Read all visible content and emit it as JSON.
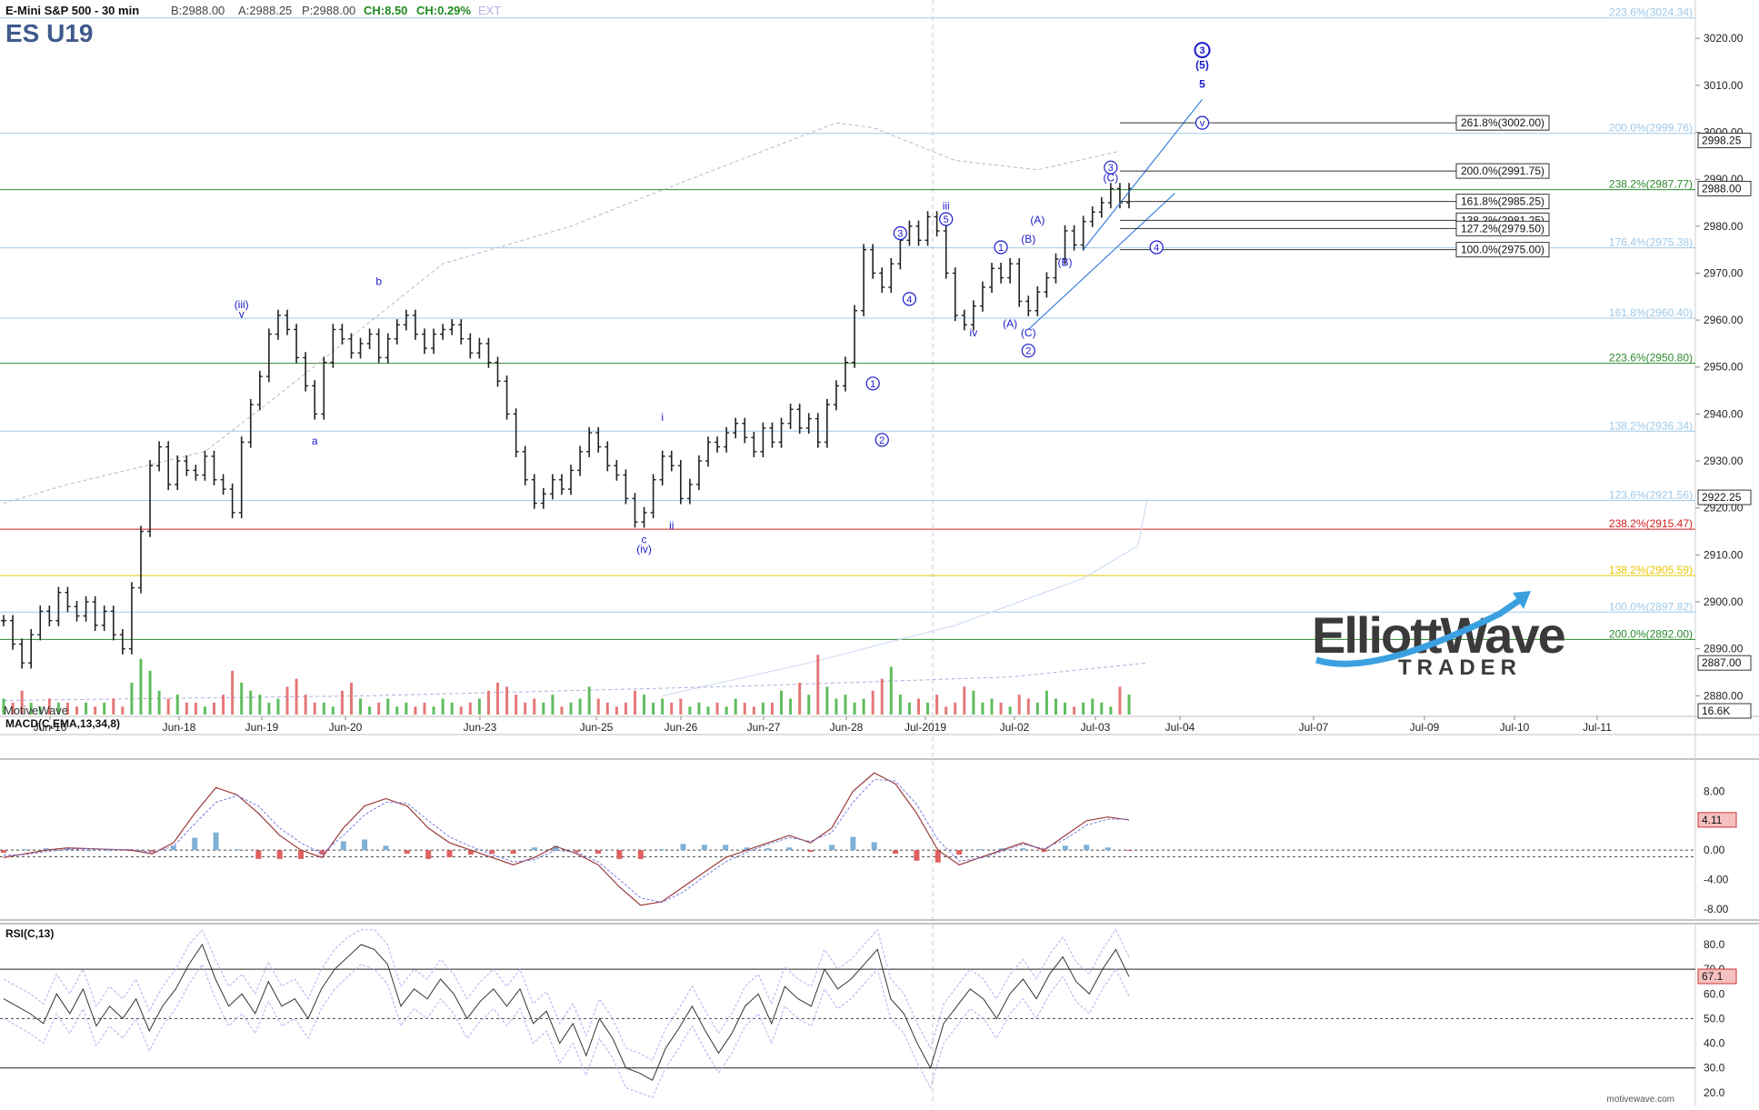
{
  "header": {
    "instrument": "E-Mini S&P 500 - 30 min",
    "quote_b": "B:2988.00",
    "quote_a": "A:2988.25",
    "quote_p": "P:2988.00",
    "quote_ch": "CH:8.50",
    "quote_chp": "CH:0.29%",
    "quote_ext": "EXT",
    "symbol": "ES U19"
  },
  "watermark": "MotiveWave",
  "footer_brand": "motivewave.com",
  "logo": {
    "line1": "ElliottWave",
    "line2": "TRADER"
  },
  "colors": {
    "bg": "#ffffff",
    "bar": "#222222",
    "fib_blue": "#9fc9e8",
    "fib_green": "#2f8a2f",
    "fib_red": "#d42020",
    "fib_yellow": "#e8c600",
    "wave": "#1a1acc",
    "channel": "#3a7fd9",
    "vol_up": "#43b243",
    "vol_down": "#e06060",
    "macd_line": "#9b3a3a",
    "macd_signal": "#7a7ae0",
    "hist_pos": "#7fb0d6",
    "hist_neg": "#e06060"
  },
  "chart_data": [
    {
      "type": "line",
      "title": "E-Mini S&P 500 - 30 min",
      "subtitle": "ES U19",
      "x_tick_labels": [
        "Jun-16",
        "Jun-18",
        "Jun-19",
        "Jun-20",
        "Jun-23",
        "Jun-25",
        "Jun-26",
        "Jun-27",
        "Jun-28",
        "Jul-2019",
        "Jul-02",
        "Jul-03",
        "Jul-04",
        "Jul-07",
        "Jul-09",
        "Jul-10",
        "Jul-11"
      ],
      "y_tick_labels": [
        "3020.00",
        "3010.00",
        "3000.00",
        "2990.00",
        "2980.00",
        "2970.00",
        "2960.00",
        "2950.00",
        "2940.00",
        "2930.00",
        "2920.00",
        "2910.00",
        "2900.00",
        "2890.00",
        "2880.00"
      ],
      "ylim": [
        2876,
        3027
      ],
      "last_price_label": "2988.00",
      "price_flags": [
        "2998.25",
        "2922.25",
        "2887.00",
        "16.6K"
      ],
      "series": [
        {
          "values": [
            2896,
            2891,
            2887,
            2893,
            2898,
            2896,
            2902,
            2899,
            2897,
            2900,
            2895,
            2898,
            2893,
            2890,
            2903,
            2915,
            2929,
            2933,
            2925,
            2930,
            2928,
            2927,
            2931,
            2926,
            2924,
            2919,
            2934,
            2942,
            2948,
            2957,
            2961,
            2958,
            2952,
            2946,
            2940,
            2951,
            2958,
            2956,
            2953,
            2955,
            2957,
            2952,
            2956,
            2959,
            2961,
            2957,
            2954,
            2957,
            2958,
            2959,
            2956,
            2953,
            2955,
            2951,
            2947,
            2940,
            2932,
            2926,
            2921,
            2923,
            2926,
            2924,
            2928,
            2932,
            2936,
            2933,
            2929,
            2927,
            2922,
            2917,
            2919,
            2926,
            2931,
            2929,
            2922,
            2925,
            2930,
            2934,
            2933,
            2936,
            2938,
            2935,
            2932,
            2937,
            2934,
            2938,
            2941,
            2937,
            2939,
            2934,
            2942,
            2946,
            2951,
            2962,
            2975,
            2970,
            2967,
            2972,
            2977,
            2980,
            2977,
            2982,
            2979,
            2970,
            2961,
            2959,
            2963,
            2967,
            2971,
            2969,
            2972,
            2964,
            2962,
            2966,
            2969,
            2973,
            2979,
            2976,
            2981,
            2983,
            2985,
            2988,
            2985,
            2988
          ]
        }
      ],
      "volume_values": [
        4,
        3,
        6,
        3,
        2,
        4,
        3,
        3,
        2,
        3,
        2,
        3,
        4,
        2,
        8,
        14,
        11,
        6,
        4,
        5,
        3,
        3,
        2,
        3,
        5,
        11,
        8,
        6,
        5,
        3,
        4,
        7,
        9,
        5,
        3,
        3,
        2,
        6,
        8,
        4,
        2,
        3,
        4,
        2,
        3,
        2,
        3,
        2,
        4,
        3,
        2,
        3,
        4,
        6,
        8,
        7,
        5,
        3,
        4,
        3,
        5,
        2,
        3,
        4,
        7,
        4,
        3,
        2,
        3,
        6,
        5,
        3,
        4,
        3,
        4,
        2,
        3,
        2,
        3,
        2,
        4,
        3,
        2,
        3,
        3,
        6,
        4,
        8,
        5,
        15,
        7,
        4,
        5,
        3,
        4,
        6,
        9,
        12,
        5,
        3,
        4,
        3,
        5,
        2,
        3,
        7,
        6,
        3,
        4,
        3,
        2,
        5,
        4,
        3,
        6,
        4,
        3,
        2,
        3,
        4,
        3,
        2,
        7,
        5
      ]
    },
    {
      "type": "line",
      "title": "MACD(C,EMA,13,34,8)",
      "ylim": [
        -9,
        12
      ],
      "y_tick_labels": [
        "8.00",
        "4.00",
        "0.00",
        "-4.00",
        "-8.00"
      ],
      "last_value_label": "4.11",
      "series": [
        {
          "name": "MACD",
          "values": [
            -1,
            -0.5,
            0,
            0.3,
            0.2,
            0.1,
            0,
            -0.5,
            1,
            5,
            8.5,
            7.5,
            5,
            2,
            0,
            -1,
            3,
            6,
            7,
            6,
            3,
            1,
            0,
            -1,
            -2,
            -1,
            0.5,
            -0.5,
            -2,
            -5,
            -7.5,
            -7,
            -5,
            -3,
            -1,
            0,
            1,
            2,
            1,
            3,
            8,
            10.5,
            9,
            5,
            0,
            -2,
            -1,
            0,
            1,
            0,
            2,
            4,
            4.5,
            4.1
          ]
        },
        {
          "name": "Signal",
          "values": [
            -0.7,
            -0.6,
            -0.2,
            0.1,
            0.2,
            0.1,
            0.1,
            -0.3,
            0.5,
            3.6,
            6.5,
            7.4,
            6,
            3,
            1,
            -0.5,
            2,
            4.8,
            6.5,
            6.4,
            4,
            1.8,
            0.5,
            -0.6,
            -1.6,
            -1.3,
            0,
            -0.3,
            -1.6,
            -4,
            -6.5,
            -7.1,
            -5.7,
            -3.6,
            -1.6,
            -0.3,
            0.8,
            1.7,
            1.2,
            2.4,
            6.5,
            9.6,
            9.4,
            6.2,
            1.4,
            -1.5,
            -1.1,
            -0.2,
            0.8,
            0.2,
            1.5,
            3.4,
            4.2,
            4.2
          ]
        }
      ]
    },
    {
      "type": "line",
      "title": "RSI(C,13)",
      "ylim": [
        17,
        87
      ],
      "y_tick_labels": [
        "80.0",
        "70.0",
        "60.0",
        "50.0",
        "40.0",
        "30.0",
        "20.0"
      ],
      "last_value_label": "67.1",
      "series": [
        {
          "name": "RSI",
          "values": [
            58,
            55,
            52,
            48,
            60,
            52,
            62,
            47,
            55,
            50,
            58,
            45,
            55,
            62,
            72,
            80,
            66,
            55,
            60,
            52,
            65,
            55,
            58,
            50,
            62,
            70,
            75,
            80,
            78,
            72,
            55,
            62,
            58,
            66,
            60,
            50,
            57,
            62,
            55,
            62,
            48,
            53,
            40,
            48,
            35,
            50,
            42,
            30,
            28,
            25,
            38,
            46,
            55,
            45,
            36,
            44,
            55,
            60,
            48,
            63,
            58,
            55,
            70,
            62,
            66,
            72,
            78,
            58,
            52,
            40,
            30,
            48,
            55,
            62,
            58,
            50,
            60,
            66,
            58,
            68,
            75,
            65,
            60,
            70,
            78,
            67
          ]
        }
      ]
    }
  ],
  "fib_right_labels": [
    {
      "text": "223.6%(3024.34)",
      "tone": "blue",
      "price": 3024.34
    },
    {
      "text": "200.0%(2999.76)",
      "tone": "blue",
      "price": 2999.76
    },
    {
      "text": "238.2%(2987.77)",
      "tone": "green",
      "price": 2987.77
    },
    {
      "text": "176.4%(2975.38)",
      "tone": "blue",
      "price": 2975.38
    },
    {
      "text": "161.8%(2960.40)",
      "tone": "blue",
      "price": 2960.4
    },
    {
      "text": "223.6%(2950.80)",
      "tone": "green",
      "price": 2950.8
    },
    {
      "text": "138.2%(2936.34)",
      "tone": "blue",
      "price": 2936.34
    },
    {
      "text": "123.6%(2921.56)",
      "tone": "blue",
      "price": 2921.56
    },
    {
      "text": "238.2%(2915.47)",
      "tone": "red",
      "price": 2915.47
    },
    {
      "text": "138.2%(2905.59)",
      "tone": "yellow",
      "price": 2905.59
    },
    {
      "text": "100.0%(2897.82)",
      "tone": "blue",
      "price": 2897.82
    },
    {
      "text": "200.0%(2892.00)",
      "tone": "green",
      "price": 2892.0
    }
  ],
  "fib_box_labels": [
    {
      "text": "261.8%(3002.00)",
      "price": 3002.0
    },
    {
      "text": "200.0%(2991.75)",
      "price": 2991.75
    },
    {
      "text": "161.8%(2985.25)",
      "price": 2985.25
    },
    {
      "text": "138.2%(2981.25)",
      "price": 2981.25
    },
    {
      "text": "127.2%(2979.50)",
      "price": 2979.5
    },
    {
      "text": "100.0%(2975.00)",
      "price": 2975.0
    }
  ],
  "wave_labels": [
    {
      "text": "(iii)",
      "bar": 26,
      "price": 2962.5
    },
    {
      "text": "v",
      "bar": 26,
      "price": 2960.5
    },
    {
      "text": "a",
      "bar": 34,
      "price": 2933.5
    },
    {
      "text": "b",
      "bar": 41,
      "price": 2967.5
    },
    {
      "text": "c",
      "bar": 70,
      "price": 2912.5
    },
    {
      "text": "(iv)",
      "bar": 70,
      "price": 2910.5
    },
    {
      "text": "i",
      "bar": 72,
      "price": 2938.5
    },
    {
      "text": "ii",
      "bar": 73,
      "price": 2915.5
    },
    {
      "text": "iii",
      "bar": 103,
      "price": 2983.5
    },
    {
      "text": "iv",
      "bar": 106,
      "price": 2956.5
    },
    {
      "text": "(A)",
      "bar": 110,
      "price": 2958.5
    },
    {
      "text": "(B)",
      "bar": 112,
      "price": 2976.5
    },
    {
      "text": "(A)",
      "bar": 113,
      "price": 2980.5
    },
    {
      "text": "(C)",
      "bar": 112,
      "price": 2956.5
    },
    {
      "text": "(B)",
      "bar": 116,
      "price": 2971.5
    },
    {
      "text": "(C)",
      "bar": 121,
      "price": 2989.5
    },
    {
      "text": "(5)",
      "bar": 131,
      "price": 3013.5
    },
    {
      "text": "5",
      "bar": 131,
      "price": 3009.5
    }
  ],
  "wave_circles": [
    {
      "text": "3",
      "bar": 98,
      "price": 2978.5
    },
    {
      "text": "4",
      "bar": 99,
      "price": 2964.5
    },
    {
      "text": "5",
      "bar": 103,
      "price": 2981.5
    },
    {
      "text": "1",
      "bar": 95,
      "price": 2946.5
    },
    {
      "text": "2",
      "bar": 96,
      "price": 2934.5
    },
    {
      "text": "1",
      "bar": 109,
      "price": 2975.5
    },
    {
      "text": "2",
      "bar": 112,
      "price": 2953.5
    },
    {
      "text": "3",
      "bar": 121,
      "price": 2992.5
    },
    {
      "text": "4",
      "bar": 126,
      "price": 2975.5
    },
    {
      "text": "v",
      "bar": 131,
      "price": 3002.0
    },
    {
      "text": "3",
      "bar": 131,
      "price": 3017.5
    }
  ]
}
